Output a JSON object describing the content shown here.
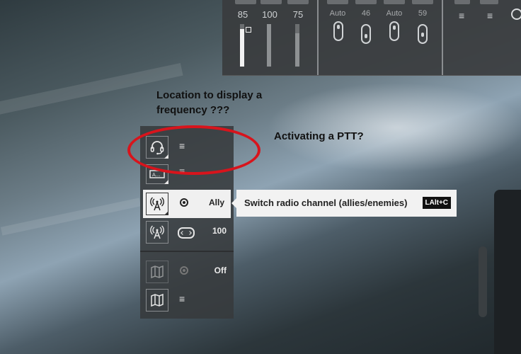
{
  "mixer": {
    "values": [
      "85",
      "100",
      "75"
    ],
    "auto_labels": [
      "Auto",
      "46",
      "Auto",
      "59"
    ],
    "bar_levels": [
      0.88,
      1.0,
      0.78
    ]
  },
  "panel": {
    "rows": [
      {
        "icon": "headset-icon",
        "menu": "≡"
      },
      {
        "icon": "text-display-icon",
        "menu": "≡"
      },
      {
        "icon": "radio-tower-icon",
        "value": "Ally"
      },
      {
        "icon": "radio-tower-icon",
        "value": "100"
      },
      {
        "icon": "map-icon",
        "value": "Off"
      },
      {
        "icon": "map-icon",
        "menu": "≡"
      }
    ]
  },
  "tooltip": {
    "text": "Switch radio channel (allies/enemies)",
    "shortcut": "LAlt+C"
  },
  "annotations": {
    "note1": "Location to display a",
    "note2": "frequency ???",
    "note3": "Activating a PTT?",
    "ellipse_color": "#d8141c"
  }
}
